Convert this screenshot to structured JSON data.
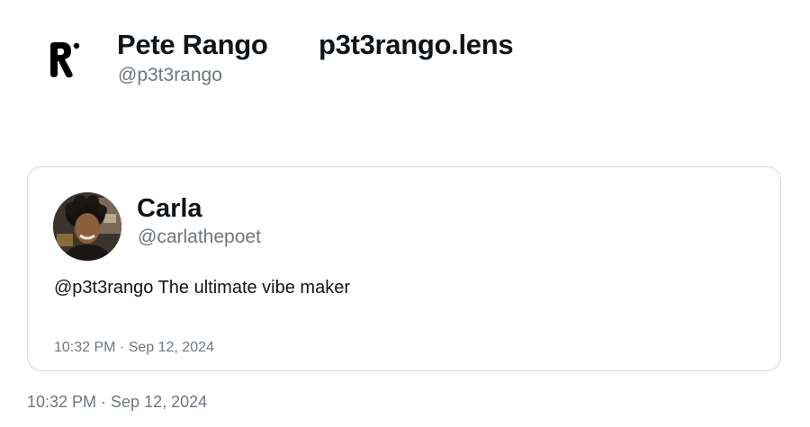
{
  "author": {
    "name": "Pete Rango",
    "extra": "p3t3rango.lens",
    "handle": "@p3t3rango",
    "logo_icon": "r-letter-logo-icon"
  },
  "quoted_tweet": {
    "author_name": "Carla",
    "author_handle": "@carlathepoet",
    "text": "@p3t3rango The ultimate vibe maker",
    "timestamp": "10:32 PM · Sep 12, 2024"
  },
  "tweet": {
    "timestamp": "10:32 PM · Sep 12, 2024"
  },
  "colors": {
    "text_primary": "#0f1419",
    "text_secondary": "#6e767d",
    "card_border": "#cfd9de",
    "background": "#ffffff"
  }
}
